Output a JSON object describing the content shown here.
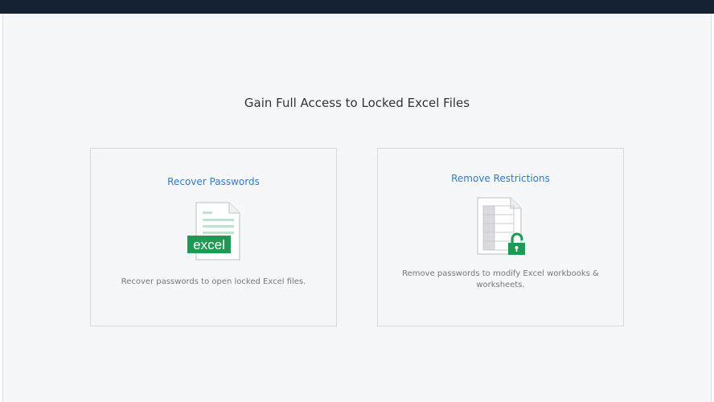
{
  "header": {
    "title": "Gain Full Access to Locked Excel Files"
  },
  "cards": [
    {
      "title": "Recover Passwords",
      "description": "Recover passwords to open locked Excel files.",
      "icon": "excel-file-icon",
      "badge": "excel"
    },
    {
      "title": "Remove Restrictions",
      "description": "Remove passwords to modify Excel workbooks & worksheets.",
      "icon": "locked-sheet-icon"
    }
  ],
  "colors": {
    "accent": "#2f7bd4",
    "green": "#1e9a55",
    "topbar": "#142233"
  }
}
